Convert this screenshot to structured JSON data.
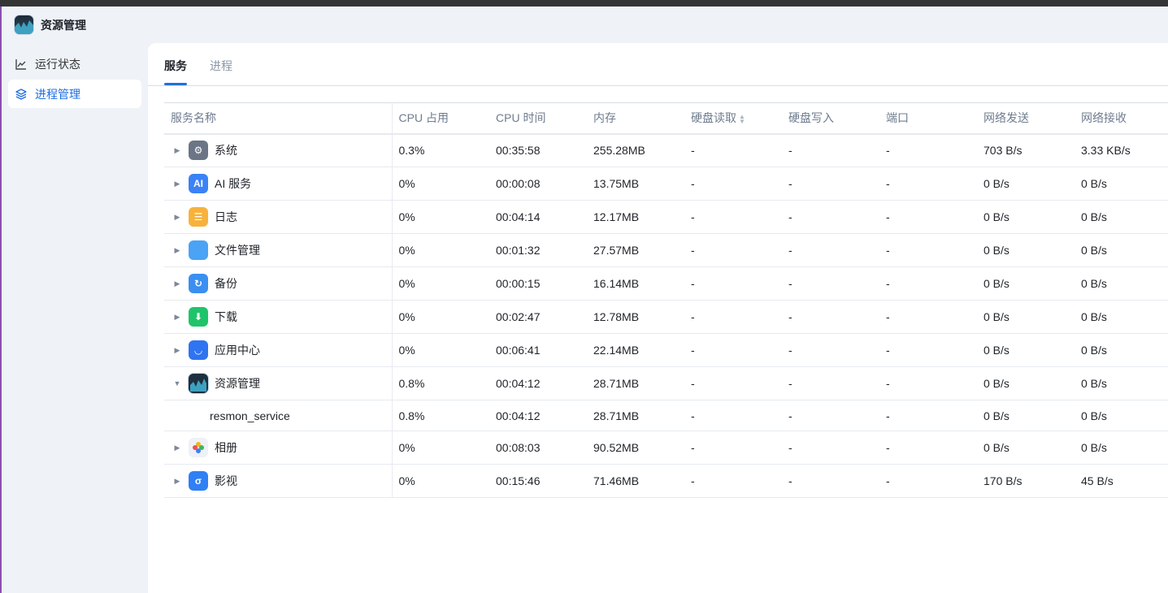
{
  "app": {
    "title": "资源管理"
  },
  "sidebar": {
    "items": [
      {
        "label": "运行状态",
        "icon": "chart-line-icon"
      },
      {
        "label": "进程管理",
        "icon": "layers-icon",
        "active": true
      }
    ]
  },
  "tabs": [
    {
      "label": "服务",
      "active": true
    },
    {
      "label": "进程"
    }
  ],
  "table": {
    "columns": [
      "服务名称",
      "CPU 占用",
      "CPU 时间",
      "内存",
      "硬盘读取",
      "硬盘写入",
      "端口",
      "网络发送",
      "网络接收"
    ],
    "sorted_column": "硬盘读取",
    "rows": [
      {
        "name": "系统",
        "icon": "gear-icon",
        "color": "#6b7585",
        "glyph": "⚙",
        "expanded": false,
        "cells": [
          "0.3%",
          "00:35:58",
          "255.28MB",
          "-",
          "-",
          "-",
          "703 B/s",
          "3.33 KB/s"
        ]
      },
      {
        "name": "AI 服务",
        "icon": "ai-icon",
        "color": "#3b82f6",
        "glyph": "AI",
        "expanded": false,
        "cells": [
          "0%",
          "00:00:08",
          "13.75MB",
          "-",
          "-",
          "-",
          "0 B/s",
          "0 B/s"
        ]
      },
      {
        "name": "日志",
        "icon": "log-icon",
        "color": "#f7b23b",
        "glyph": "☰",
        "expanded": false,
        "cells": [
          "0%",
          "00:04:14",
          "12.17MB",
          "-",
          "-",
          "-",
          "0 B/s",
          "0 B/s"
        ]
      },
      {
        "name": "文件管理",
        "icon": "folder-icon",
        "color": "#4aa3f5",
        "glyph": "",
        "expanded": false,
        "cells": [
          "0%",
          "00:01:32",
          "27.57MB",
          "-",
          "-",
          "-",
          "0 B/s",
          "0 B/s"
        ]
      },
      {
        "name": "备份",
        "icon": "backup-icon",
        "color": "#3a8ff0",
        "glyph": "↻",
        "expanded": false,
        "cells": [
          "0%",
          "00:00:15",
          "16.14MB",
          "-",
          "-",
          "-",
          "0 B/s",
          "0 B/s"
        ]
      },
      {
        "name": "下载",
        "icon": "download-icon",
        "color": "#1fc46a",
        "glyph": "⬇",
        "expanded": false,
        "cells": [
          "0%",
          "00:02:47",
          "12.78MB",
          "-",
          "-",
          "-",
          "0 B/s",
          "0 B/s"
        ]
      },
      {
        "name": "应用中心",
        "icon": "store-icon",
        "color": "#2f74f0",
        "glyph": "◡",
        "expanded": false,
        "cells": [
          "0%",
          "00:06:41",
          "22.14MB",
          "-",
          "-",
          "-",
          "0 B/s",
          "0 B/s"
        ]
      },
      {
        "name": "资源管理",
        "icon": "resource-monitor-icon",
        "color": "#1e2f3e",
        "glyph": "",
        "expanded": true,
        "cells": [
          "0.8%",
          "00:04:12",
          "28.71MB",
          "-",
          "-",
          "-",
          "0 B/s",
          "0 B/s"
        ]
      },
      {
        "name": "resmon_service",
        "child": true,
        "cells": [
          "0.8%",
          "00:04:12",
          "28.71MB",
          "-",
          "-",
          "-",
          "0 B/s",
          "0 B/s"
        ]
      },
      {
        "name": "相册",
        "icon": "photos-icon",
        "color": "#eef1f6",
        "glyph": "✿",
        "expanded": false,
        "cells": [
          "0%",
          "00:08:03",
          "90.52MB",
          "-",
          "-",
          "-",
          "0 B/s",
          "0 B/s"
        ]
      },
      {
        "name": "影视",
        "icon": "video-icon",
        "color": "#2f7ff5",
        "glyph": "σ",
        "expanded": false,
        "cells": [
          "0%",
          "00:15:46",
          "71.46MB",
          "-",
          "-",
          "-",
          "170 B/s",
          "45 B/s"
        ]
      }
    ]
  }
}
